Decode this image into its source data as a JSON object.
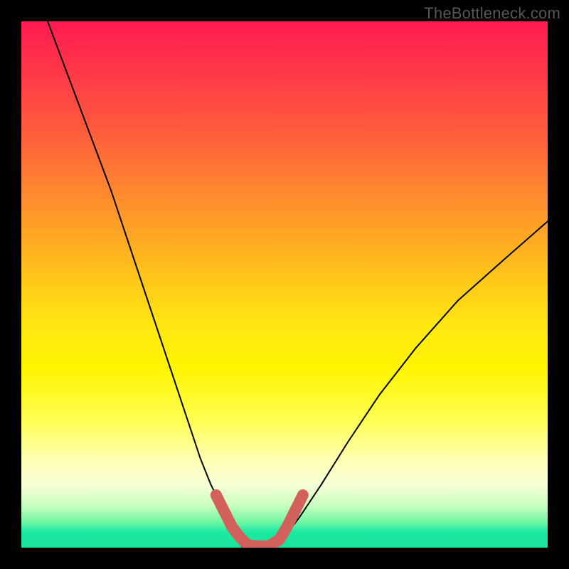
{
  "watermark": "TheBottleneck.com",
  "colors": {
    "page_bg": "#000000",
    "curve": "#000000",
    "marker": "#d2615b",
    "gradient_top": "#ff1a53",
    "gradient_mid": "#fff500",
    "gradient_bottom": "#17e39b"
  },
  "chart_data": {
    "type": "line",
    "title": "",
    "xlabel": "",
    "ylabel": "",
    "xlim": [
      0,
      100
    ],
    "ylim": [
      0,
      100
    ],
    "grid": false,
    "legend": false,
    "series": [
      {
        "name": "left-curve",
        "x": [
          5,
          8,
          11,
          14,
          17,
          20,
          23,
          26,
          29,
          32,
          34,
          36,
          38,
          40,
          41,
          42
        ],
        "y": [
          100,
          92,
          84,
          76,
          68,
          59,
          50,
          41,
          32,
          23,
          17,
          12,
          8,
          4,
          2,
          0
        ]
      },
      {
        "name": "floor",
        "x": [
          42,
          44,
          46,
          48
        ],
        "y": [
          0,
          0,
          0,
          0
        ]
      },
      {
        "name": "right-curve",
        "x": [
          48,
          50,
          53,
          57,
          62,
          68,
          75,
          83,
          92,
          100
        ],
        "y": [
          0,
          2,
          6,
          12,
          20,
          29,
          38,
          47,
          55,
          62
        ]
      }
    ],
    "markers": {
      "name": "highlight-dots",
      "note": "bold salmon segments near the minimum",
      "points": [
        {
          "x": 37,
          "y": 10
        },
        {
          "x": 38.5,
          "y": 7
        },
        {
          "x": 40,
          "y": 4
        },
        {
          "x": 41.5,
          "y": 2
        },
        {
          "x": 43,
          "y": 0.5
        },
        {
          "x": 45,
          "y": 0.3
        },
        {
          "x": 47,
          "y": 0.3
        },
        {
          "x": 49,
          "y": 1.5
        },
        {
          "x": 50.5,
          "y": 4
        },
        {
          "x": 52,
          "y": 7
        },
        {
          "x": 53.5,
          "y": 10
        }
      ]
    }
  }
}
